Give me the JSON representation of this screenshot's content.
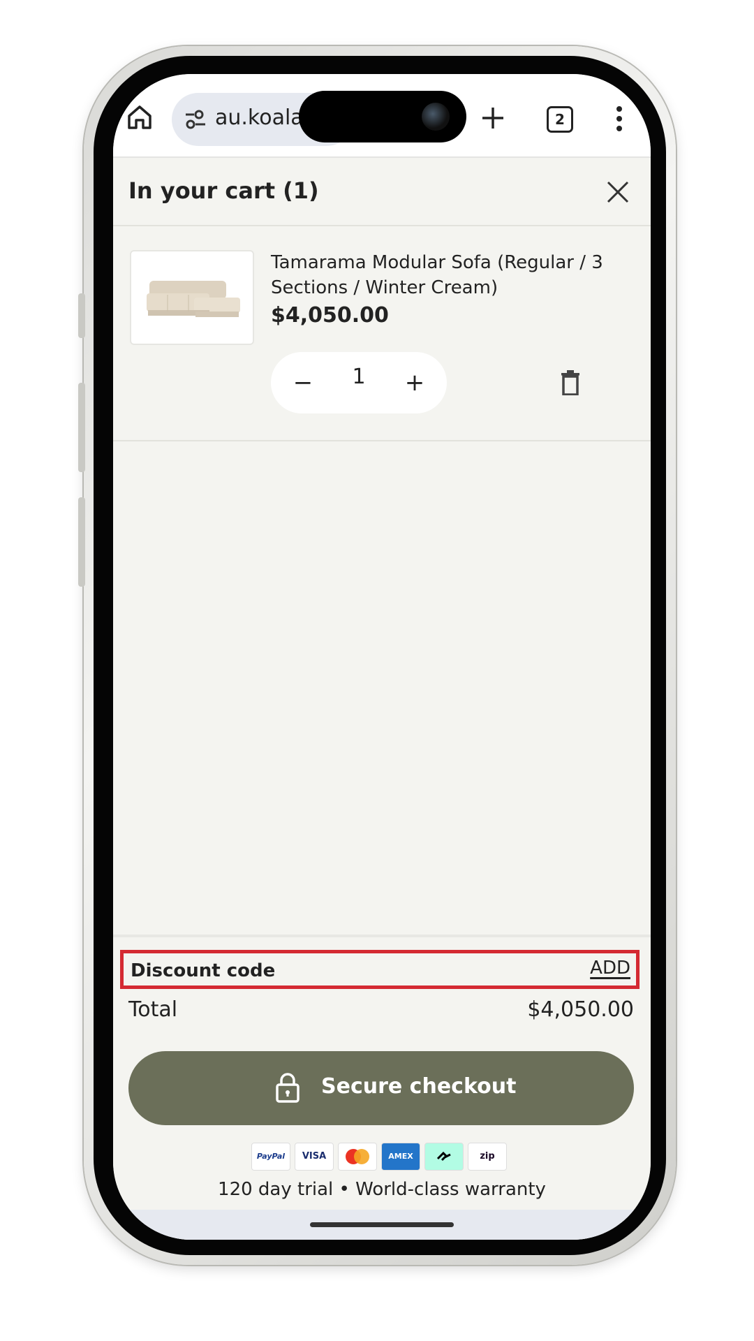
{
  "browser": {
    "url": "au.koala.",
    "tab_count": "2",
    "icons": [
      "home-icon",
      "site-settings-icon",
      "plus-icon",
      "tabs-icon",
      "more-vert-icon"
    ]
  },
  "cart": {
    "title": "In your cart (1)",
    "item": {
      "name": "Tamarama Modular Sofa (Regular / 3 Sections / Winter Cream)",
      "price": "$4,050.00",
      "quantity": "1",
      "minus": "−",
      "plus": "+"
    }
  },
  "footer": {
    "discount_label": "Discount code",
    "discount_action": "ADD",
    "total_label": "Total",
    "total_value": "$4,050.00",
    "checkout_label": "Secure checkout",
    "payments": [
      "PayPal",
      "VISA",
      "Mastercard",
      "AMEX",
      "Afterpay",
      "Zip"
    ],
    "payment_labels": {
      "paypal": "PayPal",
      "visa": "VISA",
      "amex": "AMEX",
      "zip": "zip"
    },
    "trial_text": "120 day trial • World-class warranty"
  },
  "colors": {
    "checkout_button": "#6b6f59",
    "highlight": "#d42a32",
    "background": "#f4f4f0"
  }
}
